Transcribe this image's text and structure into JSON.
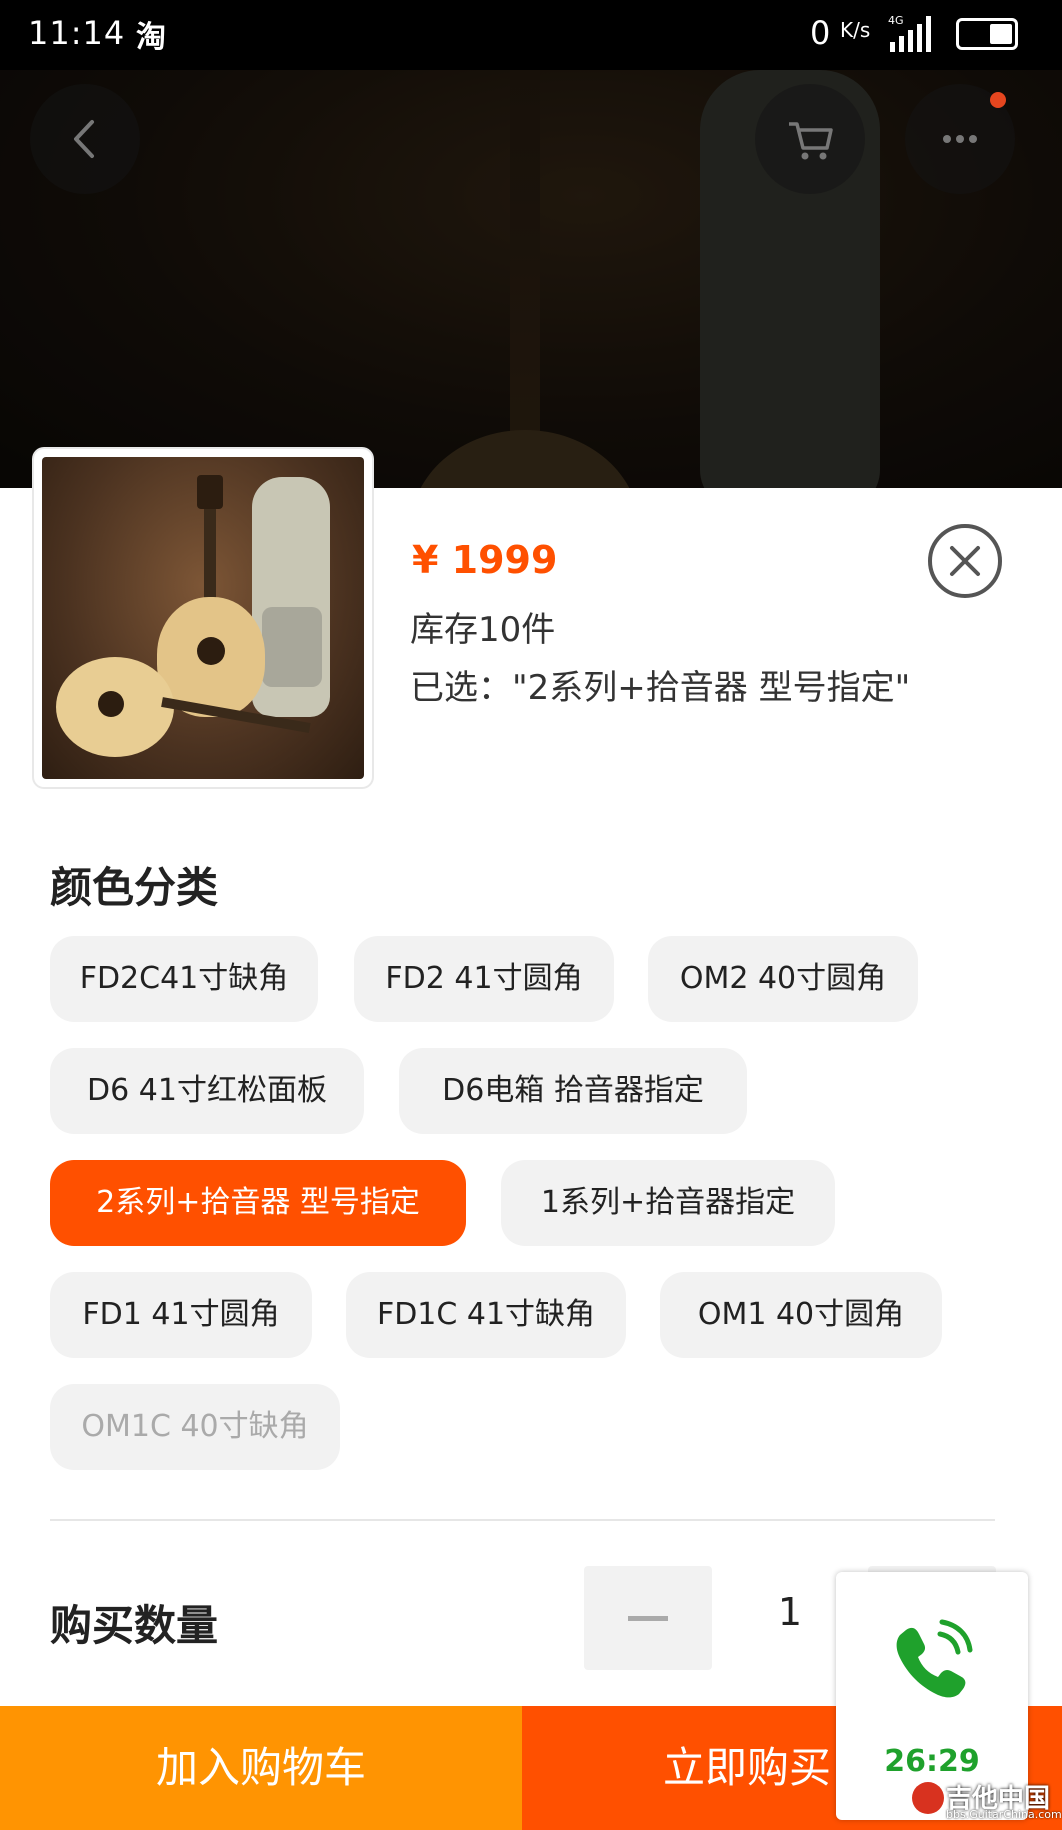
{
  "status_bar": {
    "time": "11:14",
    "app_icon_char": "淘",
    "net_speed": "0",
    "net_unit": "K/s",
    "network_type": "4G"
  },
  "product": {
    "price": "¥ 1999",
    "stock": "库存10件",
    "selected": "已选：\"2系列+拾音器 型号指定\""
  },
  "sku_section": {
    "title": "颜色分类",
    "options": [
      {
        "label": "FD2C41寸缺角",
        "state": "normal"
      },
      {
        "label": "FD2 41寸圆角",
        "state": "normal"
      },
      {
        "label": "OM2 40寸圆角",
        "state": "normal"
      },
      {
        "label": "D6 41寸红松面板",
        "state": "normal"
      },
      {
        "label": "D6电箱 拾音器指定",
        "state": "normal"
      },
      {
        "label": "2系列+拾音器 型号指定",
        "state": "selected"
      },
      {
        "label": "1系列+拾音器指定",
        "state": "normal"
      },
      {
        "label": "FD1 41寸圆角",
        "state": "normal"
      },
      {
        "label": "FD1C 41寸缺角",
        "state": "normal"
      },
      {
        "label": "OM1  40寸圆角",
        "state": "normal"
      },
      {
        "label": "OM1C 40寸缺角",
        "state": "disabled"
      }
    ]
  },
  "quantity": {
    "title": "购买数量",
    "value": "1"
  },
  "actions": {
    "add_to_cart": "加入购物车",
    "buy_now": "立即购买"
  },
  "call_widget": {
    "duration": "26:29"
  },
  "watermark": {
    "main": "吉他中国",
    "sub": "bbs.GuitarChina.com"
  },
  "colors": {
    "accent": "#ff5000",
    "cart_button": "#ff9402",
    "call_green": "#1fa12c"
  }
}
